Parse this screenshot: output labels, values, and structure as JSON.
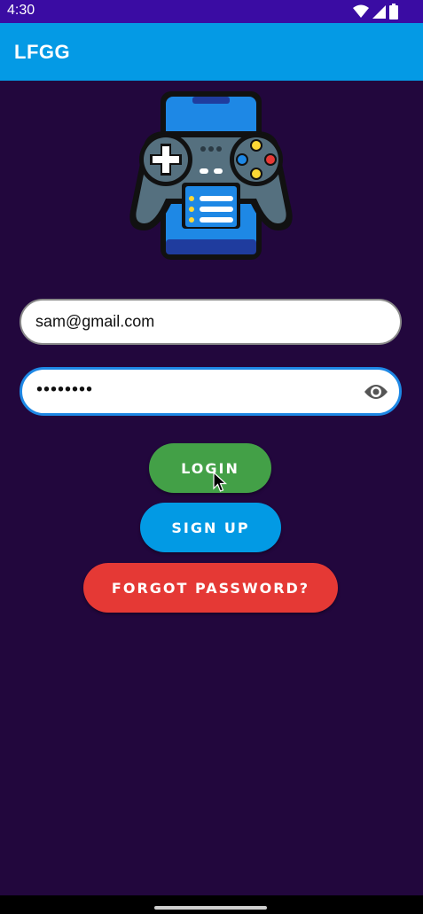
{
  "status_bar": {
    "time": "4:30",
    "icons": [
      "wifi-icon",
      "signal-icon",
      "battery-icon"
    ]
  },
  "app_bar": {
    "title": "LFGG",
    "color": "#049ae5"
  },
  "logo": {
    "icon": "phone-gamepad-icon"
  },
  "login_form": {
    "email_value": "sam@gmail.com",
    "password_value": "••••••••",
    "password_toggle_icon": "eye-icon"
  },
  "buttons": {
    "login": "LOGIN",
    "signup": "SIGN UP",
    "forgot": "FORGOT PASSWORD?"
  },
  "colors": {
    "background": "#22073d",
    "status_bar": "#3a0ca3",
    "login": "#43a047",
    "signup": "#029ae4",
    "forgot": "#e53935"
  }
}
